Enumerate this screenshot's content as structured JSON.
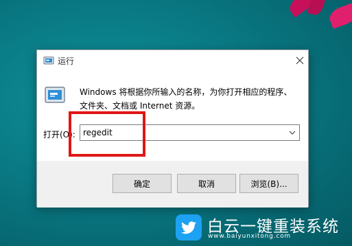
{
  "dialog": {
    "title": "运行",
    "icon": "run-icon",
    "close_icon": "close-icon",
    "description": "Windows 将根据你所输入的名称，为你打开相应的程序、文件夹、文档或 Internet 资源。",
    "open_label": "打开(O):",
    "open_value": "regedit",
    "buttons": {
      "ok": "确定",
      "cancel": "取消",
      "browse": "浏览(B)..."
    }
  },
  "annotation": {
    "highlight_color": "#e01616"
  },
  "watermark": {
    "name": "白云一键重装系统",
    "url": "www.baiyunxitong.com",
    "logo_icon": "twitter-bird-icon",
    "logo_color": "#1da1f2"
  }
}
